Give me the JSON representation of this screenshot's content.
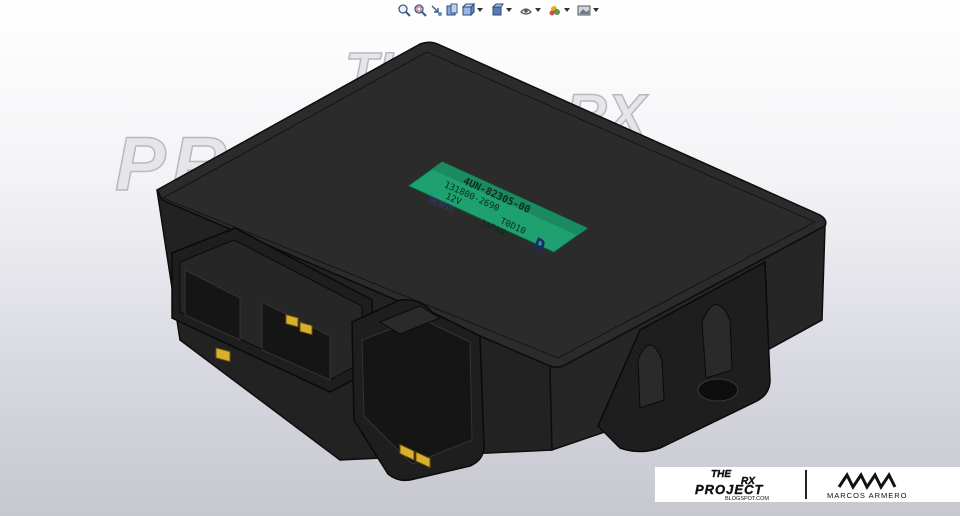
{
  "toolbar": {
    "items": [
      {
        "name": "zoom-to-fit",
        "icon": "zoom-fit-icon",
        "has_dropdown": false
      },
      {
        "name": "zoom-to-area",
        "icon": "zoom-area-icon",
        "has_dropdown": false
      },
      {
        "name": "previous-view",
        "icon": "previous-view-icon",
        "has_dropdown": false
      },
      {
        "name": "section-view",
        "icon": "section-view-icon",
        "has_dropdown": false
      },
      {
        "name": "view-orientation",
        "icon": "view-orientation-icon",
        "has_dropdown": true
      },
      {
        "name": "display-style",
        "icon": "display-style-icon",
        "has_dropdown": true
      },
      {
        "name": "hide-show-items",
        "icon": "hide-show-icon",
        "has_dropdown": true
      },
      {
        "name": "edit-appearance",
        "icon": "appearance-icon",
        "has_dropdown": true
      },
      {
        "name": "apply-scene",
        "icon": "scene-icon",
        "has_dropdown": true
      }
    ]
  },
  "watermark": {
    "line1": "THE",
    "line2": "RX",
    "line3": "PROJECT"
  },
  "part_label": {
    "part_number": "4UN-82305-00",
    "serial": "131800-2690",
    "voltage": "12V",
    "date_code": "T0D10",
    "brand": "DENSO",
    "country": "JAPAN",
    "grade": "D"
  },
  "footer": {
    "left_title_1": "THE",
    "left_title_2": "RX",
    "left_title_3": "PROJECT",
    "left_site": "BLOGSPOT.COM",
    "right_author": "MARCOS ARMERO"
  },
  "colors": {
    "housing": "#2a2a2a",
    "housing_dark": "#1c1c1c",
    "label_green": "#1fa070",
    "pin_gold": "#d8b12a"
  }
}
